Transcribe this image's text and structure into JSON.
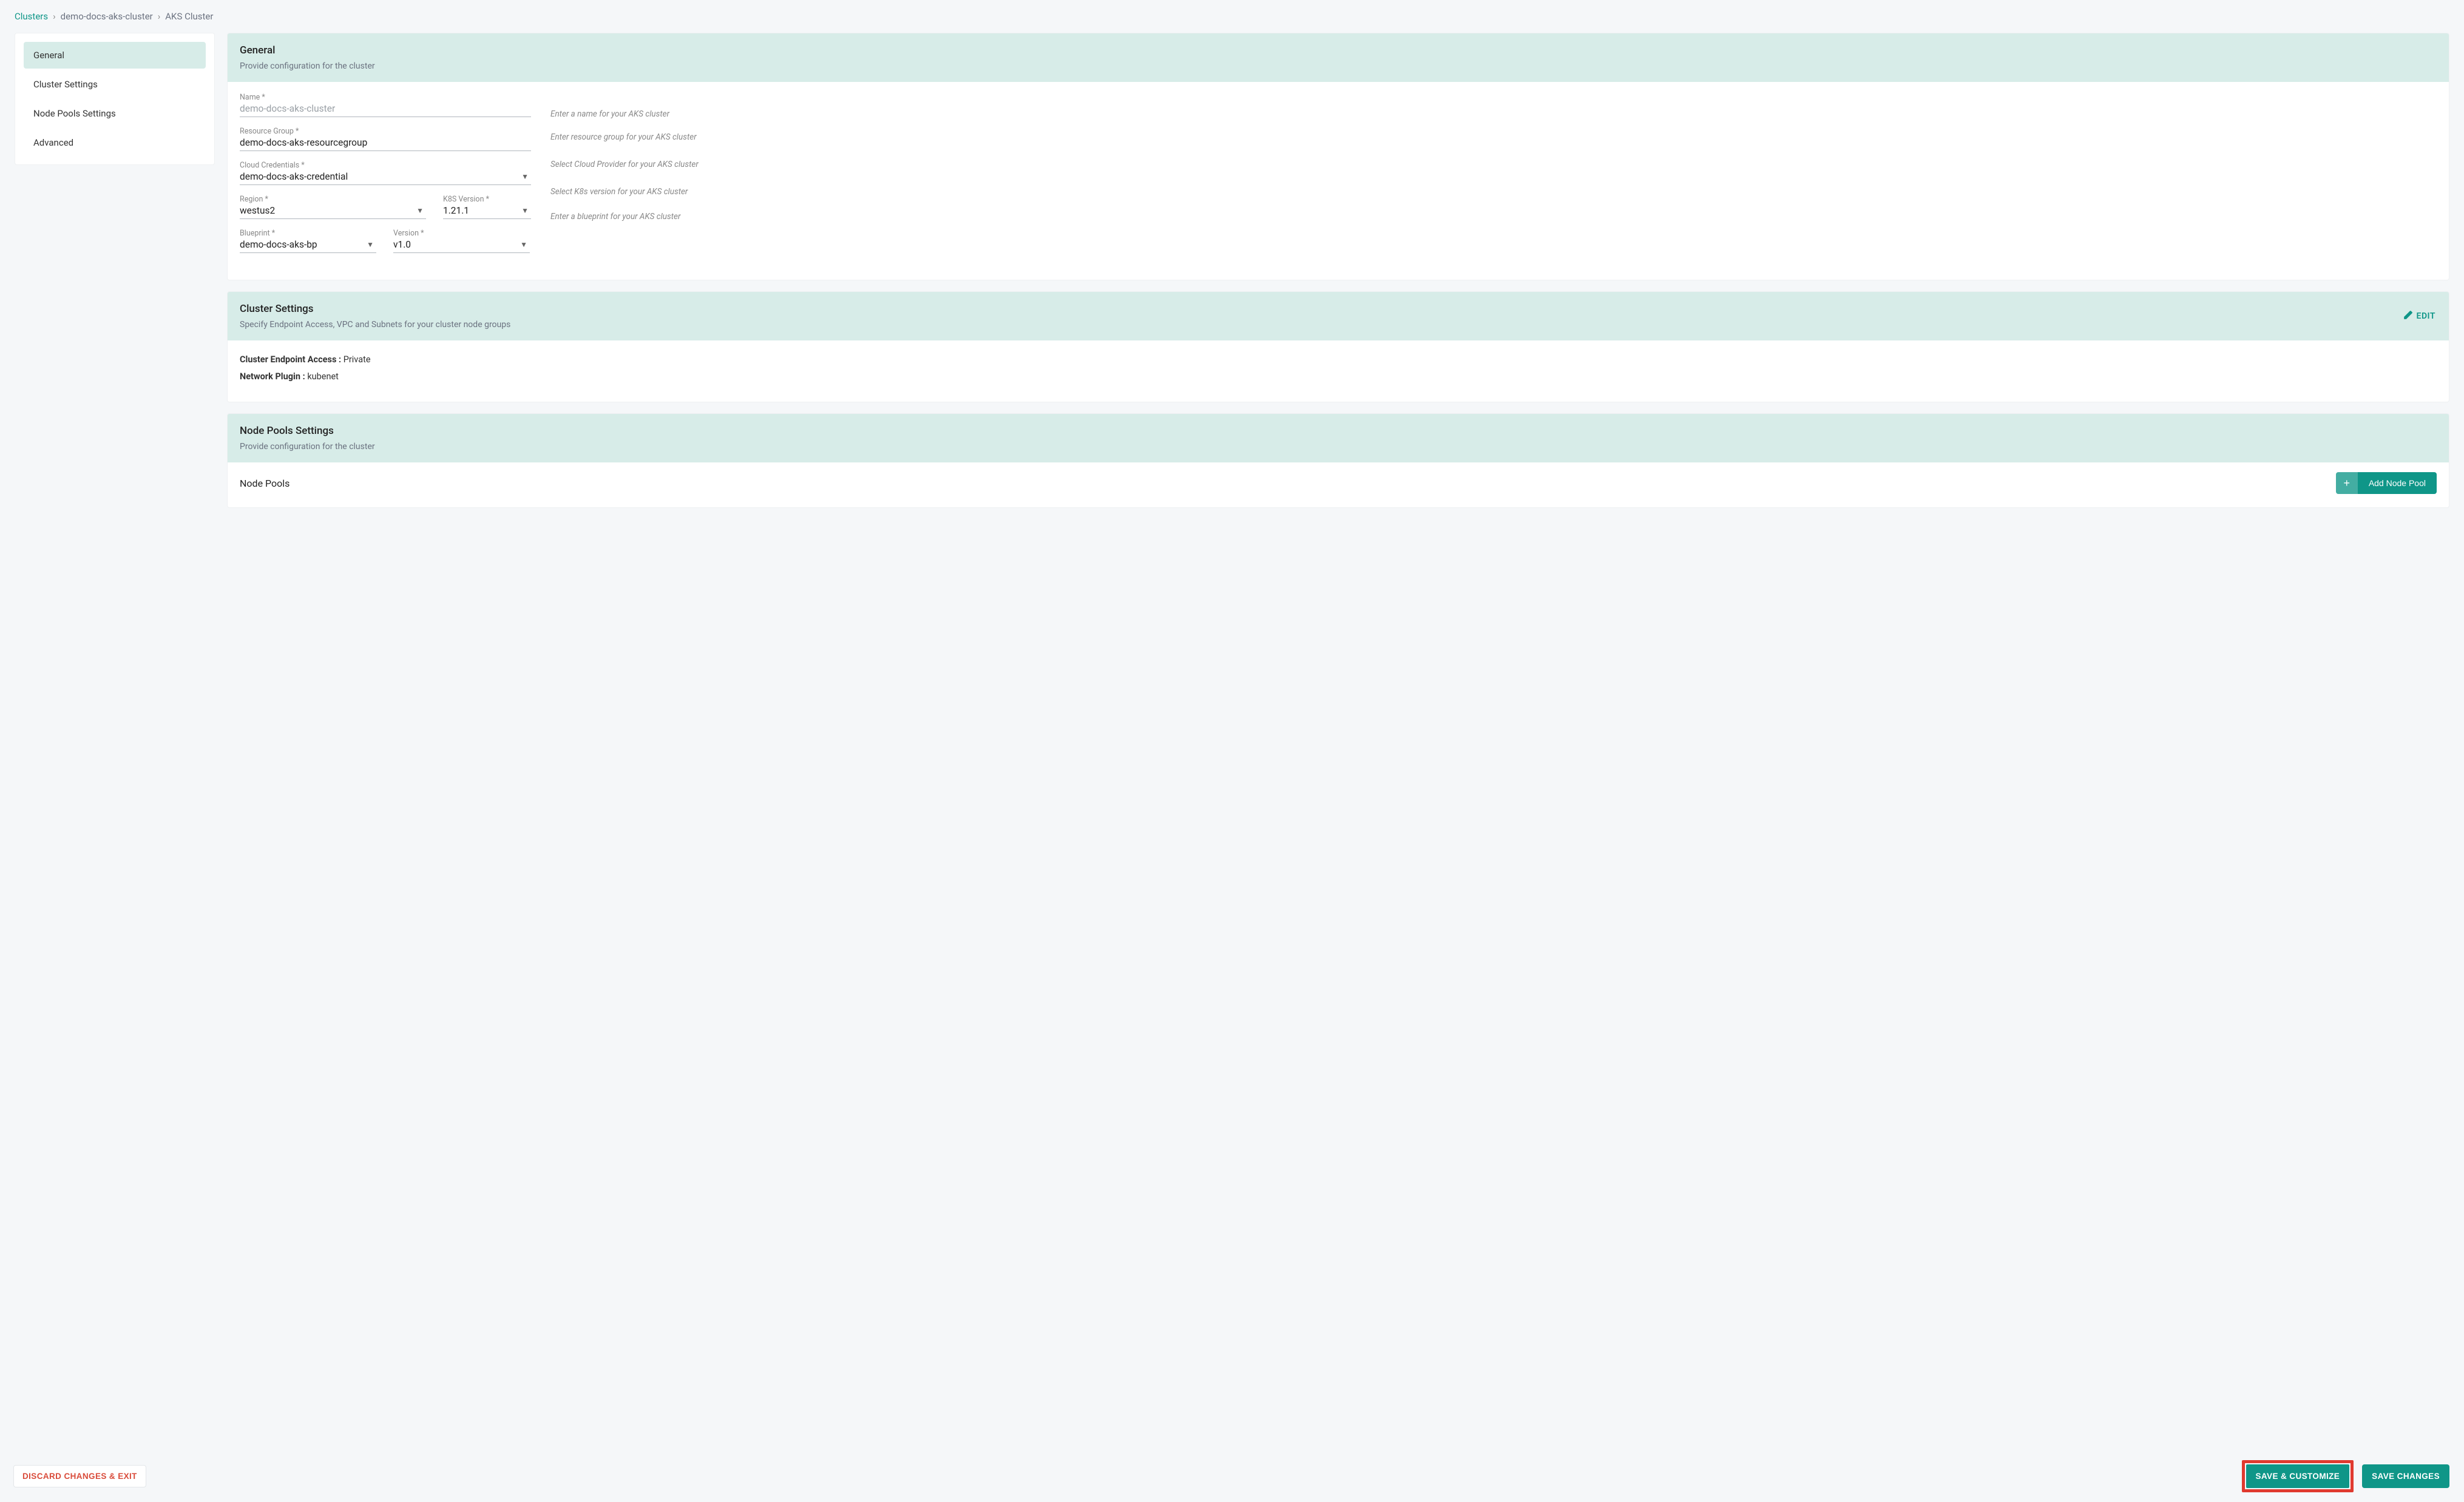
{
  "breadcrumb": {
    "root": "Clusters",
    "mid": "demo-docs-aks-cluster",
    "leaf": "AKS Cluster"
  },
  "sidebar": {
    "items": [
      {
        "label": "General",
        "active": true
      },
      {
        "label": "Cluster Settings",
        "active": false
      },
      {
        "label": "Node Pools Settings",
        "active": false
      },
      {
        "label": "Advanced",
        "active": false
      }
    ]
  },
  "general": {
    "title": "General",
    "subtitle": "Provide configuration for the cluster",
    "fields": {
      "name": {
        "label": "Name *",
        "value": "demo-docs-aks-cluster"
      },
      "resource_group": {
        "label": "Resource Group *",
        "value": "demo-docs-aks-resourcegroup"
      },
      "credentials": {
        "label": "Cloud Credentials *",
        "value": "demo-docs-aks-credential"
      },
      "region": {
        "label": "Region *",
        "value": "westus2"
      },
      "k8s_version": {
        "label": "K8S Version *",
        "value": "1.21.1"
      },
      "blueprint": {
        "label": "Blueprint *",
        "value": "demo-docs-aks-bp"
      },
      "version": {
        "label": "Version *",
        "value": "v1.0"
      }
    },
    "help": {
      "name": "Enter a name for your AKS cluster",
      "resource_group": "Enter resource group for your AKS cluster",
      "credentials": "Select Cloud Provider for your AKS cluster",
      "k8s": "Select K8s version for your AKS cluster",
      "blueprint": "Enter a blueprint for your AKS cluster"
    }
  },
  "cluster_settings": {
    "title": "Cluster Settings",
    "subtitle": "Specify Endpoint Access, VPC and Subnets for your cluster node groups",
    "edit_label": "EDIT",
    "kv": {
      "endpoint_label": "Cluster Endpoint Access : ",
      "endpoint_value": "Private",
      "network_label": "Network Plugin : ",
      "network_value": "kubenet"
    }
  },
  "node_pools": {
    "title": "Node Pools Settings",
    "subtitle": "Provide configuration for the cluster",
    "section": "Node Pools",
    "add_label": "Add Node Pool"
  },
  "footer": {
    "discard": "DISCARD CHANGES & EXIT",
    "save_customize": "SAVE & CUSTOMIZE",
    "save_changes": "SAVE CHANGES"
  },
  "colors": {
    "accent": "#0f9688",
    "highlight": "#e03a2f"
  }
}
